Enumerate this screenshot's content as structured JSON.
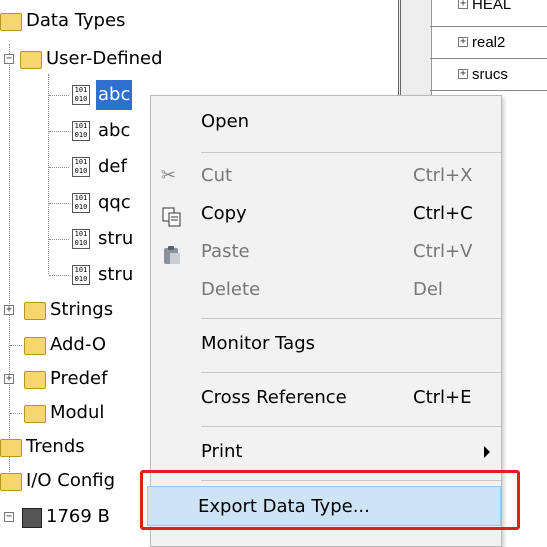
{
  "tree": {
    "data_types": "Data Types",
    "user_defined": "User-Defined",
    "udt_items": [
      "abc",
      "abc",
      "def",
      "qqc",
      "stru",
      "stru"
    ],
    "strings": "Strings",
    "add_on": "Add-O",
    "predefined": "Predef",
    "module": "Modul",
    "trends": "Trends",
    "io_config": "I/O Config",
    "plc": "1769 B",
    "dt_icon_text": "101\n010"
  },
  "panel": {
    "rows": [
      "HEAL",
      "real2",
      "srucs"
    ]
  },
  "menu": {
    "open": "Open",
    "cut": "Cut",
    "cut_key": "Ctrl+X",
    "copy": "Copy",
    "copy_key": "Ctrl+C",
    "paste": "Paste",
    "paste_key": "Ctrl+V",
    "delete": "Delete",
    "delete_key": "Del",
    "monitor_tags": "Monitor Tags",
    "cross_reference": "Cross Reference",
    "cross_reference_key": "Ctrl+E",
    "print": "Print",
    "export_data_type": "Export Data Type..."
  },
  "colors": {
    "selection": "#2e6fd1",
    "highlight": "#cde4f7",
    "annotation": "#e02020"
  }
}
